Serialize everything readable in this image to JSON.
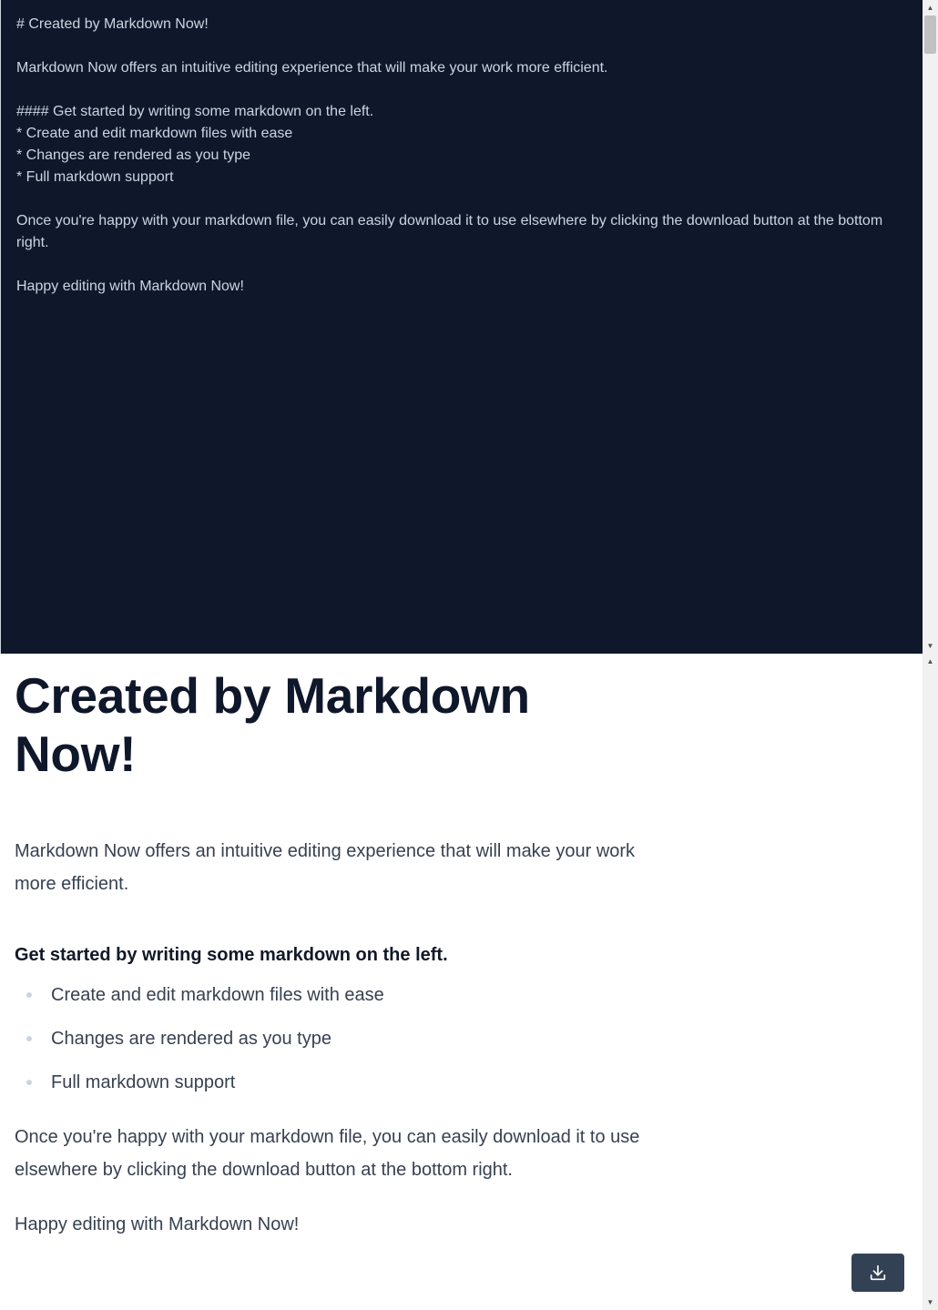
{
  "editor": {
    "content": "# Created by Markdown Now!\n\nMarkdown Now offers an intuitive editing experience that will make your work more efficient.\n\n#### Get started by writing some markdown on the left.\n* Create and edit markdown files with ease\n* Changes are rendered as you type\n* Full markdown support\n\nOnce you're happy with your markdown file, you can easily download it to use elsewhere by clicking the download button at the bottom right.\n\nHappy editing with Markdown Now!"
  },
  "preview": {
    "title": "Created by Markdown Now!",
    "intro": "Markdown Now offers an intuitive editing experience that will make your work more efficient.",
    "subheading": "Get started by writing some markdown on the left.",
    "list": [
      "Create and edit markdown files with ease",
      "Changes are rendered as you type",
      "Full markdown support"
    ],
    "download_paragraph": "Once you're happy with your markdown file, you can easily download it to use elsewhere by clicking the download button at the bottom right.",
    "closing": "Happy editing with Markdown Now!"
  },
  "download_button": {
    "icon": "download-icon"
  },
  "colors": {
    "editor_bg": "#0f172a",
    "editor_text": "#cbd5e1",
    "button_bg": "#334155"
  }
}
